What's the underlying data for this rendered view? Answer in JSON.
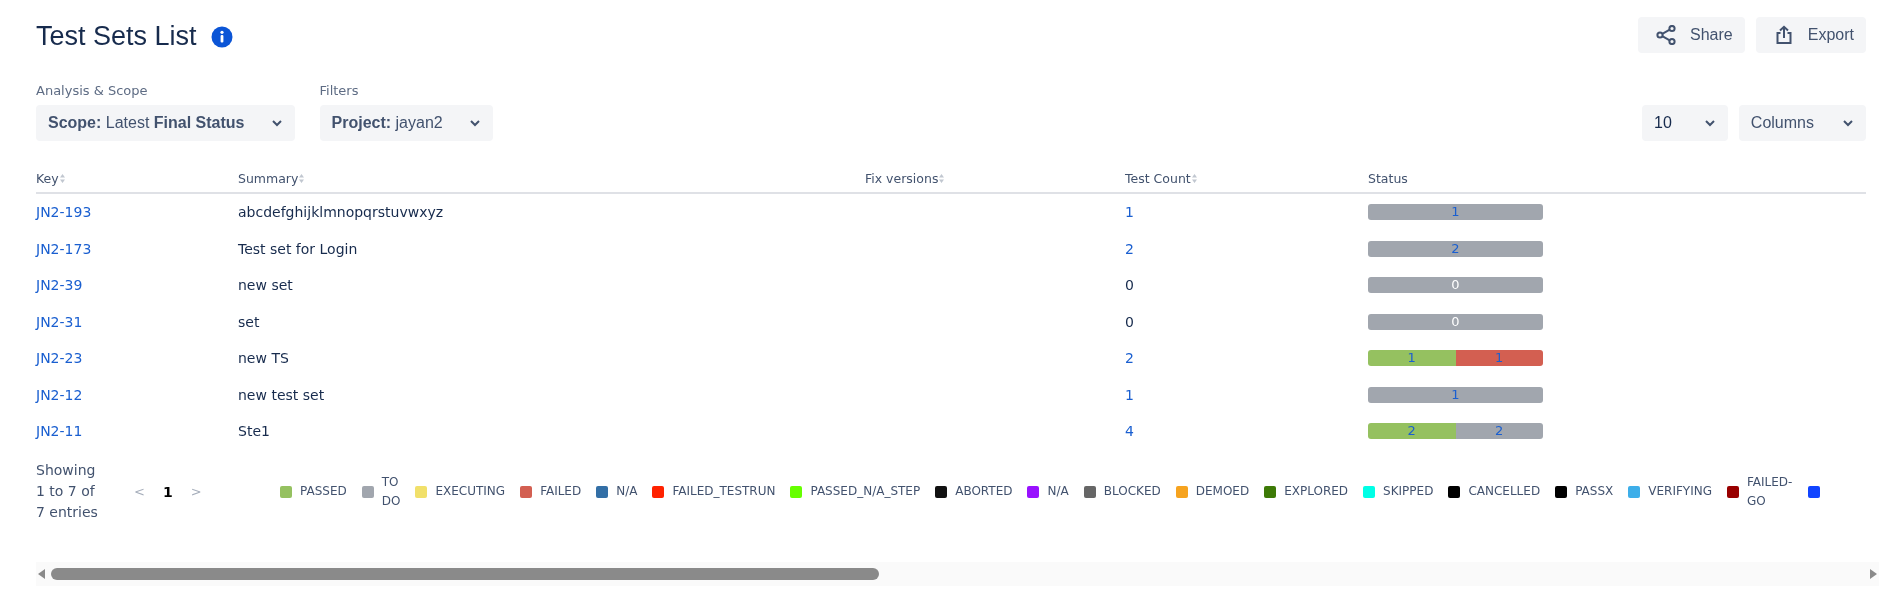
{
  "header": {
    "title": "Test Sets List",
    "actions": [
      {
        "kind": "share",
        "label": "Share"
      },
      {
        "kind": "export",
        "label": "Export"
      }
    ]
  },
  "filters": [
    {
      "caption": "Analysis & Scope",
      "value": "**Scope:** Latest **Final Status**"
    },
    {
      "caption": "Filters",
      "value": "**Project:** jayan2"
    }
  ],
  "page_size": {
    "value": "10"
  },
  "columns_button": {
    "label": "Columns"
  },
  "table": {
    "columns": [
      {
        "label": "Key",
        "sortable": true
      },
      {
        "label": "Summary",
        "sortable": true
      },
      {
        "label": "Fix versions",
        "sortable": true
      },
      {
        "label": "Test Count",
        "sortable": true
      },
      {
        "label": "Status",
        "sortable": false
      }
    ],
    "rows": [
      {
        "key": "JN2-193",
        "summary": "abcdefghijklmnopqrstuvwxyz",
        "count": "1",
        "count_link": true,
        "status": [
          {
            "value": "1",
            "color": "#a1a6ae",
            "level": 1
          }
        ]
      },
      {
        "key": "JN2-173",
        "summary": "Test set for Login",
        "count": "2",
        "count_link": true,
        "status": [
          {
            "value": "2",
            "color": "#a1a6ae",
            "level": 1
          }
        ]
      },
      {
        "key": "JN2-39",
        "summary": "new set",
        "count": "0",
        "count_link": false,
        "status": [
          {
            "value": "0",
            "color": "#a1a6ae",
            "level": 1
          }
        ]
      },
      {
        "key": "JN2-31",
        "summary": "set",
        "count": "0",
        "count_link": false,
        "status": [
          {
            "value": "0",
            "color": "#a1a6ae",
            "level": 1
          }
        ]
      },
      {
        "key": "JN2-23",
        "summary": "new TS",
        "count": "2",
        "count_link": true,
        "status": [
          {
            "value": "1",
            "color": "#95c160",
            "level": 0.5
          },
          {
            "value": "1",
            "color": "#d35f51",
            "level": 0.5
          }
        ]
      },
      {
        "key": "JN2-12",
        "summary": "new test set",
        "count": "1",
        "count_link": true,
        "status": [
          {
            "value": "1",
            "color": "#a1a6ae",
            "level": 1
          }
        ]
      },
      {
        "key": "JN2-11",
        "summary": "Ste1",
        "count": "4",
        "count_link": true,
        "status": [
          {
            "value": "2",
            "color": "#95c160",
            "level": 0.5
          },
          {
            "value": "2",
            "color": "#a1a6ae",
            "level": 0.5
          }
        ]
      }
    ]
  },
  "footer": {
    "summary": "Showing 1 to 7 of 7 entries",
    "pagination": [
      {
        "kind": "prev",
        "label": "<",
        "selected": false
      },
      {
        "kind": "page",
        "label": "1",
        "selected": true
      },
      {
        "kind": "next",
        "label": ">",
        "selected": false
      }
    ],
    "legend": [
      {
        "label": "PASSED",
        "color": "#95c160"
      },
      {
        "label": "TO DO",
        "color": "#a1a6ae"
      },
      {
        "label": "EXECUTING",
        "color": "#f1e06a"
      },
      {
        "label": "FAILED",
        "color": "#d35f51"
      },
      {
        "label": "N/A",
        "color": "#336fa6"
      },
      {
        "label": "FAILED_TESTRUN",
        "color": "#ff2200"
      },
      {
        "label": "PASSED_N/A_STEP",
        "color": "#66ff00"
      },
      {
        "label": "ABORTED",
        "color": "#111111"
      },
      {
        "label": "N/A",
        "color": "#9911ff"
      },
      {
        "label": "BLOCKED",
        "color": "#666666"
      },
      {
        "label": "DEMOED",
        "color": "#f6a31f"
      },
      {
        "label": "EXPLORED",
        "color": "#3d7a07"
      },
      {
        "label": "SKIPPED",
        "color": "#00ffe6"
      },
      {
        "label": "CANCELLED",
        "color": "#000000"
      },
      {
        "label": "PASSX",
        "color": "#000000"
      },
      {
        "label": "VERIFYING",
        "color": "#3daee9"
      },
      {
        "label": "FAILED-GO",
        "color": "#990000"
      },
      {
        "color": "#1144ff"
      }
    ]
  }
}
